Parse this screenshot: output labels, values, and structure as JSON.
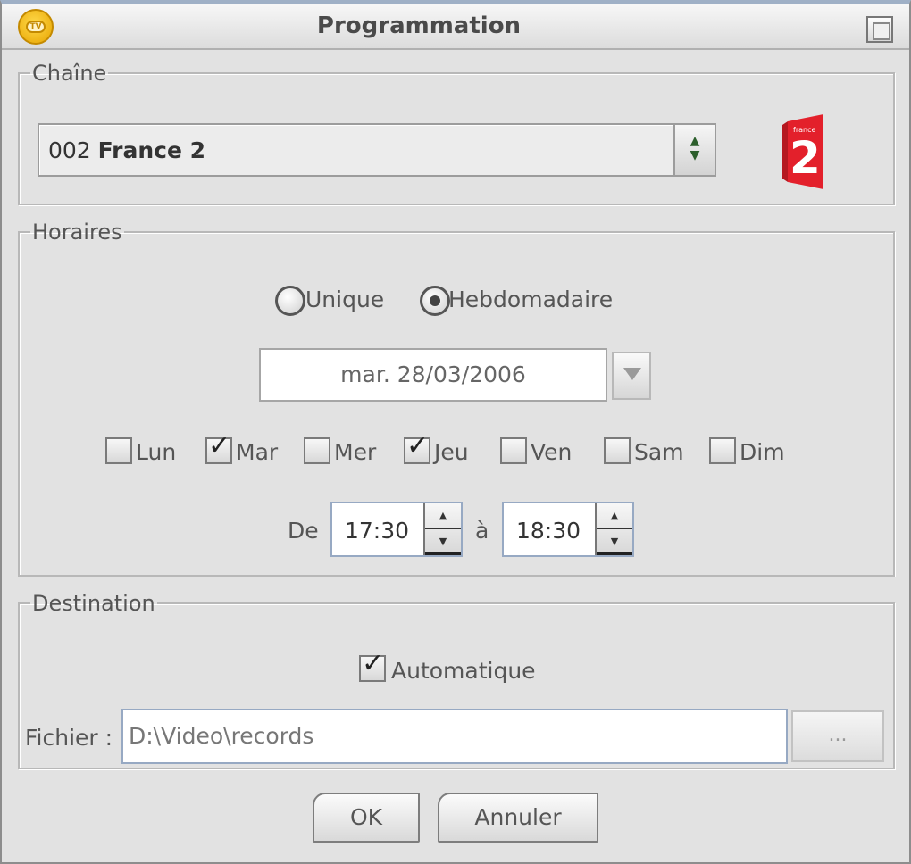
{
  "window": {
    "title": "Programmation"
  },
  "chaine": {
    "legend": "Chaîne",
    "selected_number": "002",
    "selected_name": "France 2",
    "logo_small_text": "france",
    "logo_number": "2"
  },
  "horaires": {
    "legend": "Horaires",
    "radio_unique": "Unique",
    "radio_hebdo": "Hebdomadaire",
    "selected_mode": "Hebdomadaire",
    "date": "mar. 28/03/2006",
    "days": [
      {
        "label": "Lun",
        "checked": false
      },
      {
        "label": "Mar",
        "checked": true
      },
      {
        "label": "Mer",
        "checked": false
      },
      {
        "label": "Jeu",
        "checked": true
      },
      {
        "label": "Ven",
        "checked": false
      },
      {
        "label": "Sam",
        "checked": false
      },
      {
        "label": "Dim",
        "checked": false
      }
    ],
    "from_label": "De",
    "from_time": "17:30",
    "to_label": "à",
    "to_time": "18:30"
  },
  "destination": {
    "legend": "Destination",
    "auto_label": "Automatique",
    "auto_checked": true,
    "file_label": "Fichier :",
    "file_path": "D:\\Video\\records",
    "browse_label": "..."
  },
  "buttons": {
    "ok": "OK",
    "cancel": "Annuler"
  },
  "colors": {
    "logo_red": "#e3202b",
    "titlebar_accent": "#9fb0c6"
  }
}
